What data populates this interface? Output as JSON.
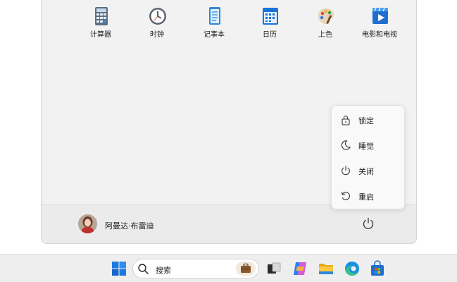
{
  "start_menu": {
    "pinned_apps": [
      {
        "label": "计算器",
        "icon": "calculator-icon"
      },
      {
        "label": "时钟",
        "icon": "clock-icon"
      },
      {
        "label": "记事本",
        "icon": "notepad-icon"
      },
      {
        "label": "日历",
        "icon": "calendar-icon"
      },
      {
        "label": "上色",
        "icon": "paint-icon"
      },
      {
        "label": "电影和电视",
        "icon": "movies-tv-icon"
      }
    ],
    "user": {
      "name": "阿曼达·布雷迪",
      "avatar": "user-avatar"
    },
    "power_button_icon": "power-icon"
  },
  "power_menu": {
    "items": [
      {
        "label": "锁定",
        "icon": "lock-icon"
      },
      {
        "label": "睡觉",
        "icon": "moon-icon"
      },
      {
        "label": "关闭",
        "icon": "power-icon"
      },
      {
        "label": "重启",
        "icon": "restart-icon"
      }
    ]
  },
  "taskbar": {
    "start_icon": "windows-start-icon",
    "search": {
      "label": "搜索",
      "icon": "search-icon",
      "badge_icon": "briefcase-icon"
    },
    "apps": [
      {
        "icon": "task-view-icon"
      },
      {
        "icon": "copilot-icon"
      },
      {
        "icon": "file-explorer-icon"
      },
      {
        "icon": "edge-browser-icon"
      },
      {
        "icon": "microsoft-store-icon"
      }
    ]
  },
  "colors": {
    "panel_bg": "#f2f2f2",
    "flyout_bg": "#f9f9f9",
    "taskbar_bg": "#eeeeee",
    "accent_blue": "#0067c0"
  }
}
